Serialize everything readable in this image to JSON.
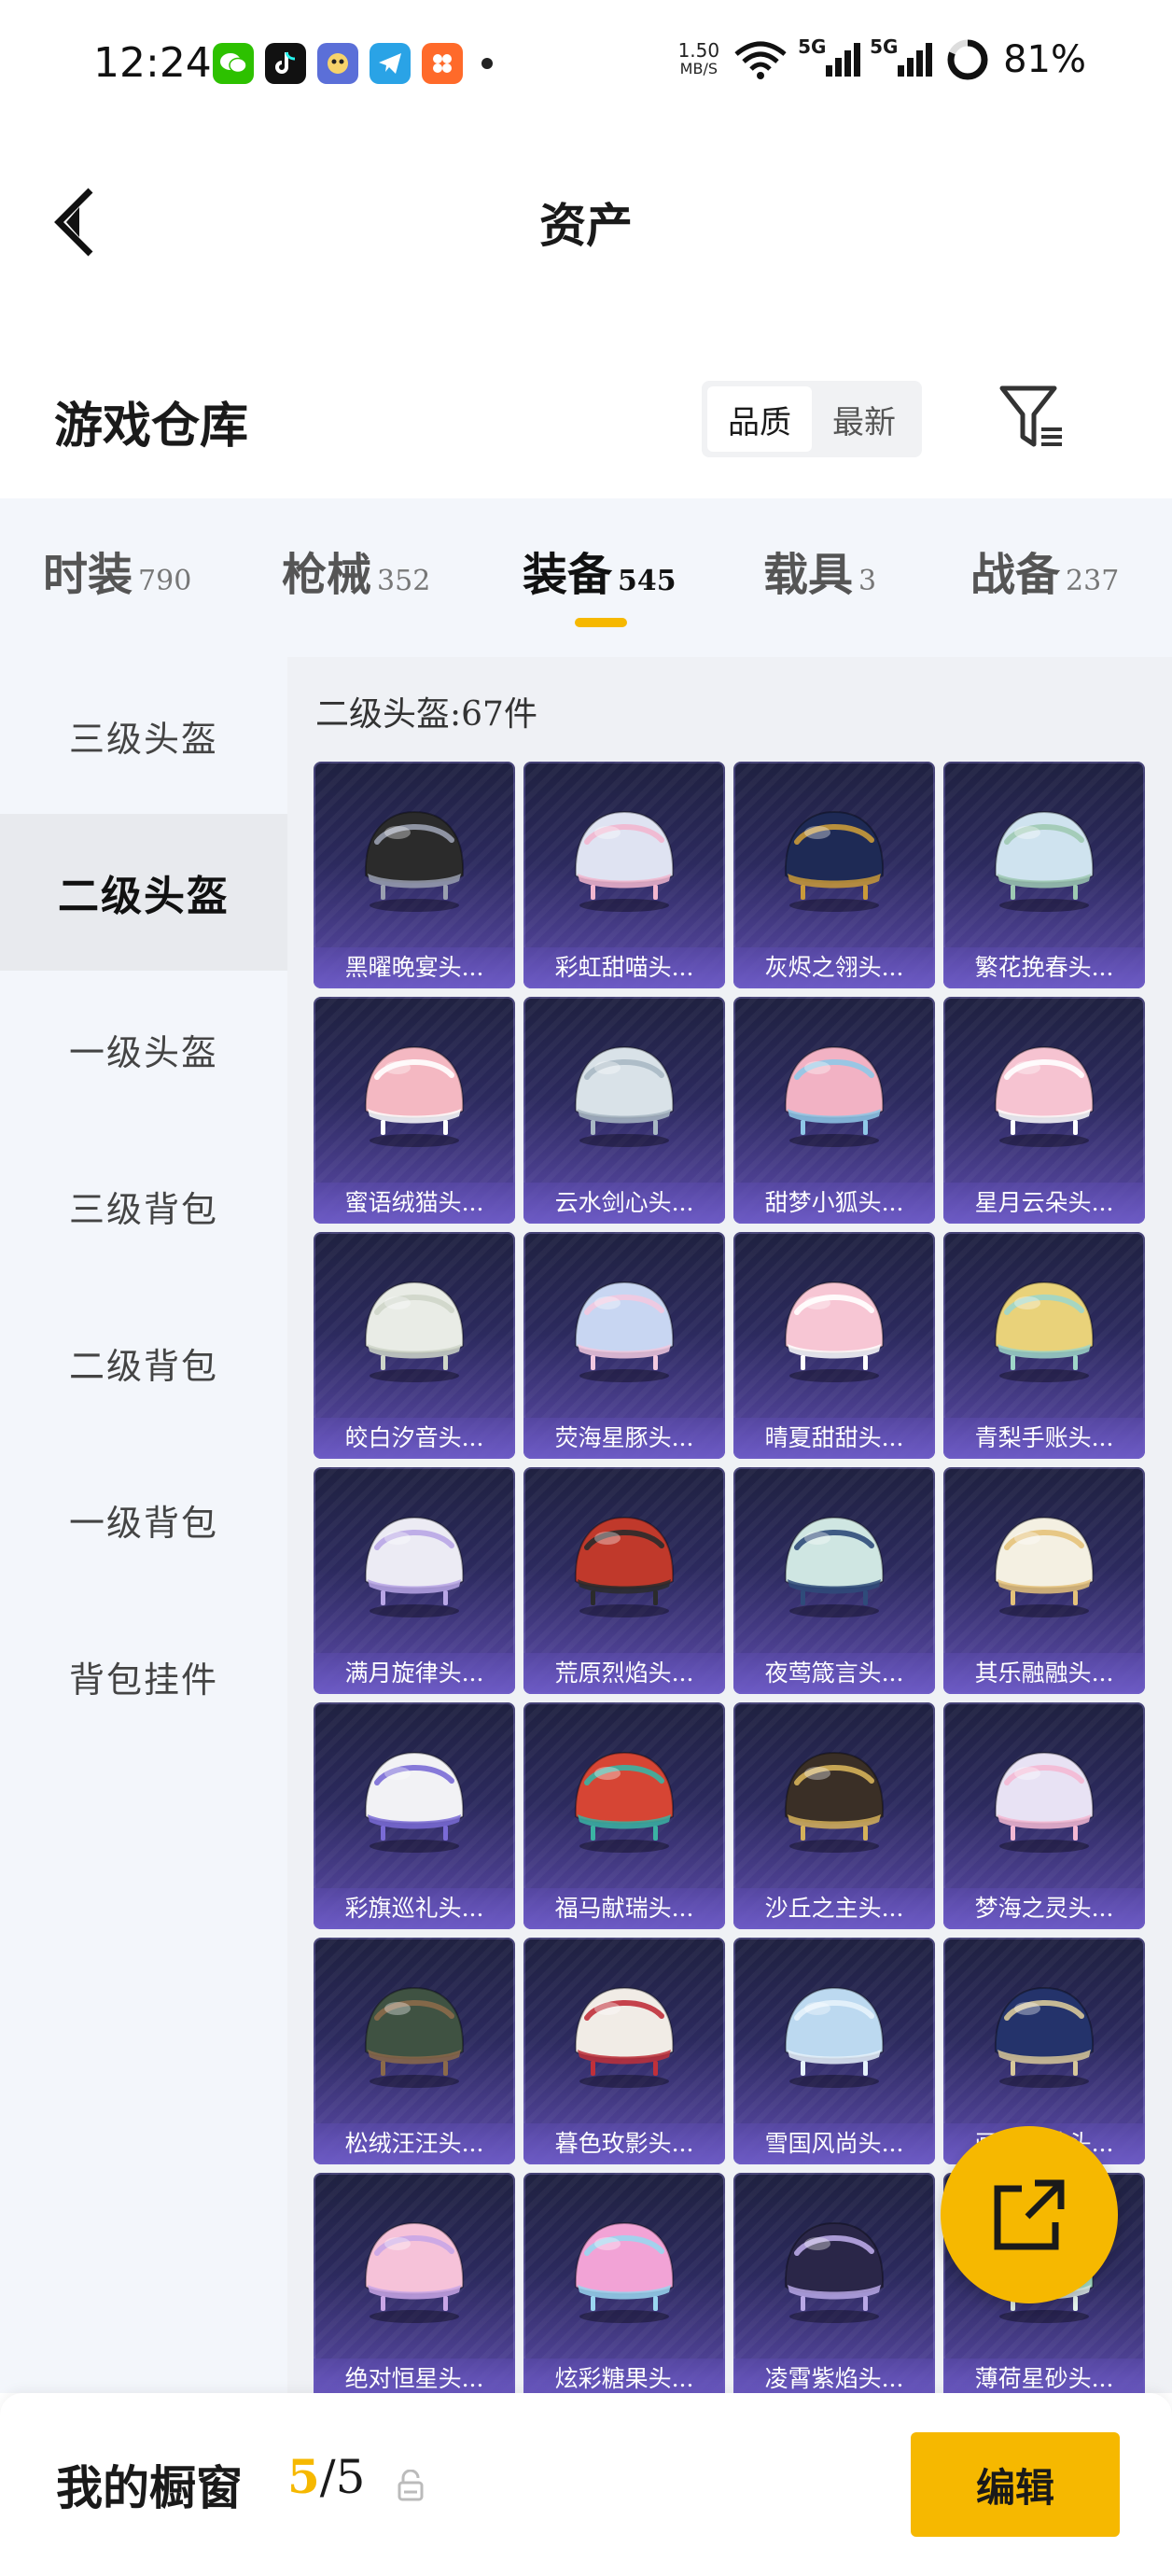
{
  "status_bar": {
    "time": "12:24",
    "net_speed": "1.50",
    "net_speed_unit": "MB/S",
    "signal_1": "5G",
    "signal_2": "5G",
    "battery": "81%",
    "icons": [
      "wechat-icon",
      "tiktok-icon",
      "game-icon",
      "telegram-icon",
      "app-icon",
      "dot-icon",
      "wifi-icon",
      "signal-icon",
      "battery-icon"
    ]
  },
  "header": {
    "title": "资产"
  },
  "warehouse": {
    "title": "游戏仓库",
    "sort_options": [
      "品质",
      "最新"
    ],
    "sort_active": "品质"
  },
  "tabs": [
    {
      "label": "时装",
      "count": "790"
    },
    {
      "label": "枪械",
      "count": "352"
    },
    {
      "label": "装备",
      "count": "545"
    },
    {
      "label": "载具",
      "count": "3"
    },
    {
      "label": "战备",
      "count": "237"
    }
  ],
  "active_tab": "装备",
  "side_nav": [
    "三级头盔",
    "二级头盔",
    "一级头盔",
    "三级背包",
    "二级背包",
    "一级背包",
    "背包挂件"
  ],
  "active_side": "二级头盔",
  "content": {
    "count_label": "二级头盔:67件",
    "items": [
      {
        "name": "黑曜晚宴头...",
        "color": "#2b2b2b",
        "accent": "#9aa0b0"
      },
      {
        "name": "彩虹甜喵头...",
        "color": "#dfe3f2",
        "accent": "#f2b6cf"
      },
      {
        "name": "灰烬之翎头...",
        "color": "#1e2a55",
        "accent": "#c99a3a"
      },
      {
        "name": "繁花挽春头...",
        "color": "#cfe3ef",
        "accent": "#9ec9b3"
      },
      {
        "name": "蜜语绒猫头...",
        "color": "#f4b8c2",
        "accent": "#ffffff"
      },
      {
        "name": "云水剑心头...",
        "color": "#d9e2e8",
        "accent": "#a9b9c4"
      },
      {
        "name": "甜梦小狐头...",
        "color": "#f2b2c4",
        "accent": "#8fc8e8"
      },
      {
        "name": "星月云朵头...",
        "color": "#f6c3d1",
        "accent": "#ffffff"
      },
      {
        "name": "皎白汐音头...",
        "color": "#e9ece6",
        "accent": "#cfd6c9"
      },
      {
        "name": "荧海星豚头...",
        "color": "#c8d6f2",
        "accent": "#f2c9e0"
      },
      {
        "name": "晴夏甜甜头...",
        "color": "#f7c6d4",
        "accent": "#ffffff"
      },
      {
        "name": "青梨手账头...",
        "color": "#e9d27a",
        "accent": "#9fd6c9"
      },
      {
        "name": "满月旋律头...",
        "color": "#ecebf4",
        "accent": "#b9a6e6"
      },
      {
        "name": "荒原烈焰头...",
        "color": "#c0392b",
        "accent": "#2b2b2b"
      },
      {
        "name": "夜莺箴言头...",
        "color": "#cfe6e2",
        "accent": "#2f4b7a"
      },
      {
        "name": "其乐融融头...",
        "color": "#f4f0e2",
        "accent": "#e5c27a"
      },
      {
        "name": "彩旗巡礼头...",
        "color": "#f2f2f5",
        "accent": "#7a6bd6"
      },
      {
        "name": "福马献瑞头...",
        "color": "#d64534",
        "accent": "#3bb3a3"
      },
      {
        "name": "沙丘之主头...",
        "color": "#3a2f26",
        "accent": "#d6b25a"
      },
      {
        "name": "梦海之灵头...",
        "color": "#e8e2f4",
        "accent": "#f4b9d4"
      },
      {
        "name": "松绒汪汪头...",
        "color": "#3f5242",
        "accent": "#8b6a4a"
      },
      {
        "name": "暮色玫影头...",
        "color": "#f1ece6",
        "accent": "#c0303a"
      },
      {
        "name": "雪国风尚头...",
        "color": "#bcd9f0",
        "accent": "#e6f2fb"
      },
      {
        "name": "画境云芯头...",
        "color": "#24336b",
        "accent": "#d8c89a"
      },
      {
        "name": "绝对恒星头...",
        "color": "#f6c2d9",
        "accent": "#c9a6e6"
      },
      {
        "name": "炫彩糖果头...",
        "color": "#f2a3d6",
        "accent": "#9ad6f0"
      },
      {
        "name": "凌霄紫焰头...",
        "color": "#2a2648",
        "accent": "#b9a8e6"
      },
      {
        "name": "薄荷星砂头...",
        "color": "#a6e0c8",
        "accent": "#e6f5ee"
      }
    ]
  },
  "bottom_bar": {
    "label": "我的橱窗",
    "current": "5",
    "total": "/5",
    "edit_label": "编辑"
  },
  "colors": {
    "accent": "#f6b800",
    "card_bg": "#2c2a5e",
    "side_bg": "#f3f6fb"
  }
}
